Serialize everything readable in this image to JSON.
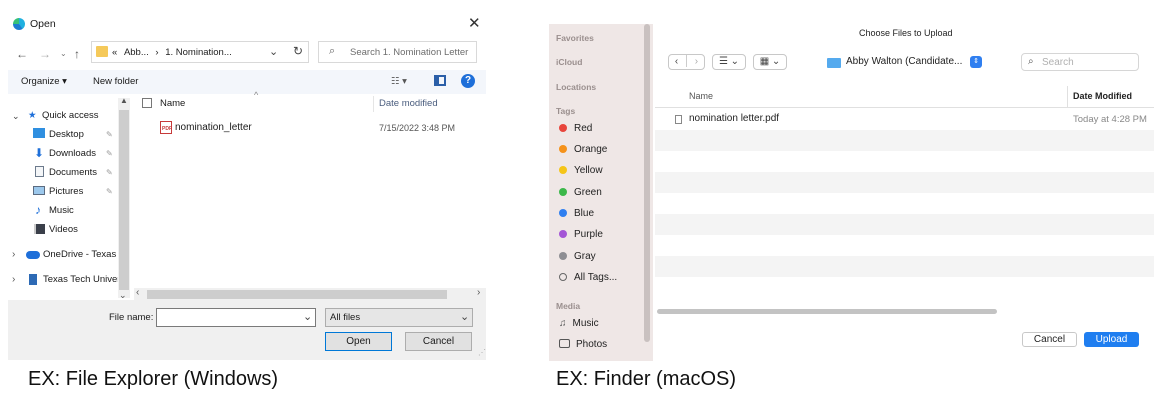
{
  "windows_dialog": {
    "title": "Open",
    "address": {
      "prefix": "«",
      "crumb1": "Abb...",
      "sep": "›",
      "crumb2": "1. Nomination..."
    },
    "search_placeholder": "Search 1. Nomination Letter",
    "toolbar": {
      "organize": "Organize ▾",
      "new_folder": "New folder"
    },
    "nav": {
      "quick_access": "Quick access",
      "items": [
        {
          "label": "Desktop",
          "icon": "desktop-icon"
        },
        {
          "label": "Downloads",
          "icon": "downloads-icon"
        },
        {
          "label": "Documents",
          "icon": "documents-icon"
        },
        {
          "label": "Pictures",
          "icon": "pictures-icon"
        },
        {
          "label": "Music",
          "icon": "music-icon"
        },
        {
          "label": "Videos",
          "icon": "videos-icon"
        }
      ],
      "onedrive": "OneDrive - Texas T",
      "ttu": "Texas Tech Univers"
    },
    "columns": {
      "name": "Name",
      "date_modified": "Date modified"
    },
    "files": [
      {
        "name": "nomination_letter",
        "date": "7/15/2022 3:48 PM",
        "icon_label": "PDF"
      }
    ],
    "file_name_label": "File name:",
    "file_name_value": "",
    "filter_value": "All files",
    "open_label": "Open",
    "cancel_label": "Cancel"
  },
  "mac_dialog": {
    "title": "Choose Files to Upload",
    "location": "Abby Walton (Candidate...",
    "search_placeholder": "Search",
    "sidebar": {
      "favorites": "Favorites",
      "icloud": "iCloud",
      "locations": "Locations",
      "tags_header": "Tags",
      "tags": [
        {
          "label": "Red",
          "color": "#e8453c"
        },
        {
          "label": "Orange",
          "color": "#f5921b"
        },
        {
          "label": "Yellow",
          "color": "#f5c518"
        },
        {
          "label": "Green",
          "color": "#3cb84a"
        },
        {
          "label": "Blue",
          "color": "#2f7ff0"
        },
        {
          "label": "Purple",
          "color": "#a456d6"
        },
        {
          "label": "Gray",
          "color": "#8e8e93"
        }
      ],
      "all_tags": "All Tags...",
      "media": "Media",
      "music": "Music",
      "photos": "Photos"
    },
    "columns": {
      "name": "Name",
      "date_modified": "Date Modified"
    },
    "files": [
      {
        "name": "nomination letter.pdf",
        "date": "Today at 4:28 PM"
      }
    ],
    "cancel_label": "Cancel",
    "upload_label": "Upload"
  },
  "captions": {
    "windows": "EX: File Explorer (Windows)",
    "mac": "EX: Finder (macOS)"
  }
}
